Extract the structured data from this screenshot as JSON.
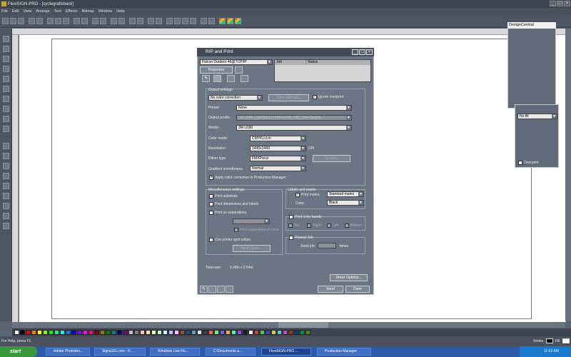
{
  "window": {
    "title": "FlexiSIGN-PRO - [cyclegrafixback]"
  },
  "menu": [
    "File",
    "Edit",
    "View",
    "Arrange",
    "Text",
    "Effects",
    "Bitmap",
    "Window",
    "Help"
  ],
  "design_central": {
    "title": "DesignCentral",
    "fill_value": "No fill",
    "overprint_label": "Overprint"
  },
  "dialog": {
    "title": "RIP and Print",
    "printer": "Falcon Outdoor 46@TCP/IP",
    "properties_label": "Properties",
    "queue_headers": [
      "Job",
      "Status"
    ],
    "output_settings": {
      "group_label": "Output settings",
      "color_correction": "No color correction",
      "color_settings_btn": "Color Settings...",
      "ignore_overprint": "Ignore overprint",
      "preset_label": "Preset:",
      "preset": "None",
      "profile_label": "Output profile:",
      "profile": "3M U180_CMYKLcLm1440x1440_NW_55in-Oprimo",
      "media_label": "Media:",
      "media": "3M U180",
      "color_mode_label": "Color mode:",
      "color_mode": "CMYKLcLm",
      "resolution_label": "Resolution:",
      "resolution": "1440x1440",
      "resolution_unit": "DPI",
      "dither_label": "Dither type:",
      "dither": "FMXPress",
      "options_btn": "Options...",
      "gradient_label": "Gradient smoothness:",
      "gradient": "Normal",
      "apply_cc": "Apply color correction in Production Manager"
    },
    "misc": {
      "group_label": "Miscellaneous settings",
      "print_substrate": "Print substrate",
      "print_dimensions": "Print dimensions and labels",
      "print_separations": "Print as separations",
      "sep_combo": "",
      "print_sep_color": "Print separations in color",
      "use_spot": "Use printer spot colors",
      "spot_btn": "Spot Colors..."
    },
    "labels_marks": {
      "group_label": "Labels and marks",
      "print_marks": "Print marks:",
      "marks_value": "Standard marks",
      "color_label": "Color:",
      "color_value": "Black"
    },
    "color_bands": {
      "label": "Print color bands",
      "items": [
        "Top",
        "Right",
        "Left",
        "Bottom"
      ]
    },
    "repeat": {
      "label": "Repeat Job",
      "send_label": "Send job",
      "times": "times",
      "count": ""
    },
    "total_size_label": "Total size:",
    "total_size": "5.08in x 2.54in",
    "driver_btn": "Driver Options...",
    "send_btn": "Send",
    "done_btn": "Done"
  },
  "status": {
    "help": "For Help, press F1",
    "stroke_label": "Stroke",
    "fill_label": "Fill"
  },
  "taskbar": {
    "start": "start",
    "tasks": [
      "Adobe Photosho...",
      "Signs101.com - R...",
      "Windows Live Ho...",
      "C:\\Documents a...",
      "FlexiSIGN-PRO ...",
      "Production Manager"
    ],
    "time": "11:53 AM"
  },
  "palette_colors": [
    "#ffffff",
    "#000000",
    "#ff0000",
    "#ff8000",
    "#ffff00",
    "#80ff00",
    "#00ff00",
    "#00ff80",
    "#00ffff",
    "#0080ff",
    "#0000ff",
    "#8000ff",
    "#ff00ff",
    "#ff0080",
    "#800000",
    "#808000",
    "#008000",
    "#008080",
    "#000080",
    "#800080",
    "#c0c0c0",
    "#808080",
    "#ffc0c0",
    "#ffe0a0",
    "#ffffc0",
    "#c0ffc0",
    "#c0ffff",
    "#c0c0ff",
    "#ffc0ff",
    "#a05020",
    "#205080",
    "#60a0c0",
    "#e0e0e0",
    "#404040",
    "#ff6060",
    "#60ff60",
    "#6060ff",
    "#ffa040",
    "#40ffa0",
    "#a040ff",
    "#202020",
    "#f0f0f0",
    "#d04040",
    "#40d040",
    "#4040d0",
    "#d0d040",
    "#40d0d0",
    "#d040d0",
    "#904000",
    "#004090",
    "#009040",
    "#409000"
  ]
}
